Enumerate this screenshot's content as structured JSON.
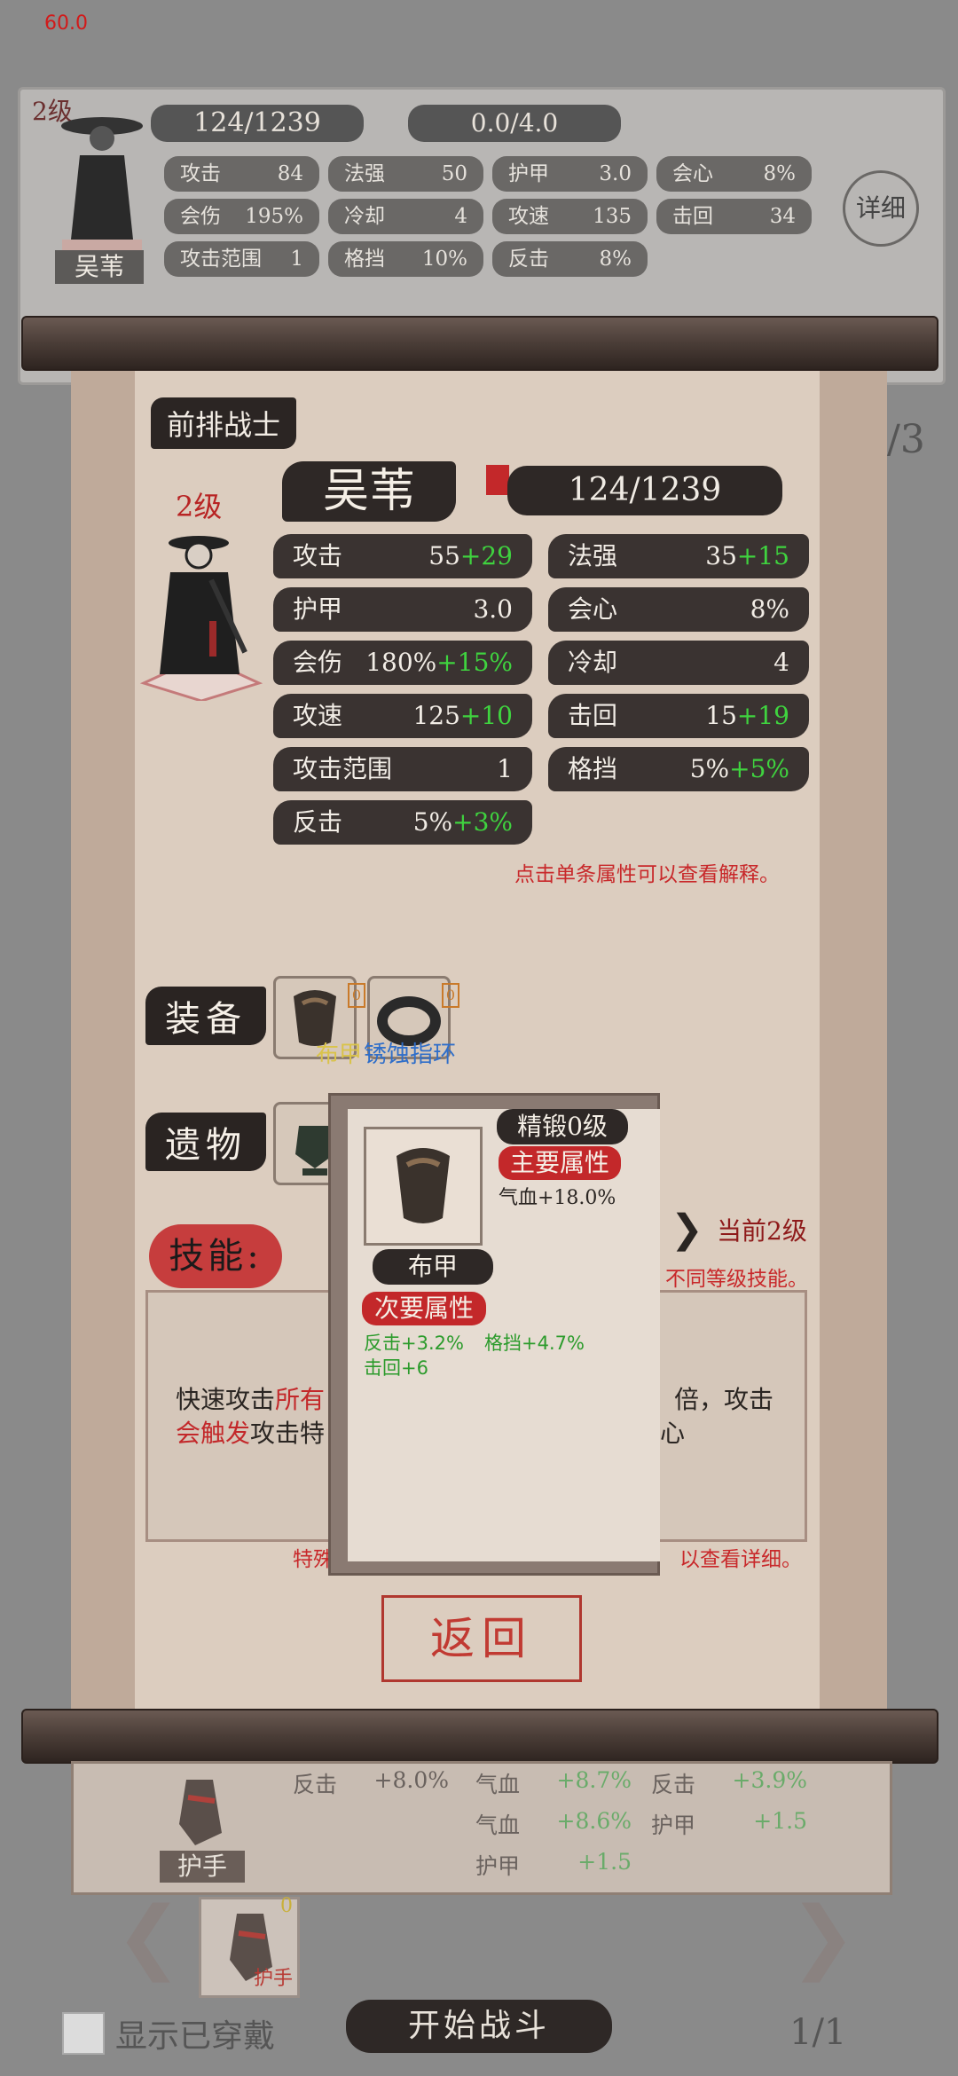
{
  "fps": "60.0",
  "bg_panel": {
    "level": "2级",
    "hp": "124/1239",
    "energy": "0.0/4.0",
    "name": "吴苇",
    "detail": "详细",
    "stats": [
      {
        "label": "攻击",
        "value": "84"
      },
      {
        "label": "法强",
        "value": "50"
      },
      {
        "label": "护甲",
        "value": "3.0"
      },
      {
        "label": "会心",
        "value": "8%"
      },
      {
        "label": "会伤",
        "value": "195%"
      },
      {
        "label": "冷却",
        "value": "4"
      },
      {
        "label": "攻速",
        "value": "135"
      },
      {
        "label": "击回",
        "value": "34"
      },
      {
        "label": "攻击范围",
        "value": "1"
      },
      {
        "label": "格挡",
        "value": "10%"
      },
      {
        "label": "反击",
        "value": "8%"
      }
    ],
    "page_hint": "/3"
  },
  "hero": {
    "role": "前排战士",
    "level": "2级",
    "name": "吴苇",
    "hp": "124/1239",
    "stats": [
      {
        "label": "攻击",
        "base": "55",
        "bonus": "+29"
      },
      {
        "label": "法强",
        "base": "35",
        "bonus": "+15"
      },
      {
        "label": "护甲",
        "base": "3.0",
        "bonus": ""
      },
      {
        "label": "会心",
        "base": "8%",
        "bonus": ""
      },
      {
        "label": "会伤",
        "base": "180%",
        "bonus": "+15%"
      },
      {
        "label": "冷却",
        "base": "4",
        "bonus": ""
      },
      {
        "label": "攻速",
        "base": "125",
        "bonus": "+10"
      },
      {
        "label": "击回",
        "base": "15",
        "bonus": "+19"
      },
      {
        "label": "攻击范围",
        "base": "1",
        "bonus": ""
      },
      {
        "label": "格挡",
        "base": "5%",
        "bonus": "+5%"
      },
      {
        "label": "反击",
        "base": "5%",
        "bonus": "+3%"
      }
    ],
    "stat_hint": "点击单条属性可以查看解释。"
  },
  "equipment": {
    "label": "装备",
    "items": [
      {
        "name": "布甲",
        "badge": "0"
      },
      {
        "name": "锈蚀指环",
        "badge": "0"
      }
    ]
  },
  "relics": {
    "label": "遗物"
  },
  "skill": {
    "label": "技能:",
    "current_level": "当前2级",
    "level_hint": "不同等级技能。",
    "desc_line1_a": "快速攻击",
    "desc_line1_b": "所有",
    "desc_line1_c": "倍，攻击",
    "desc_line2_a": "会触发",
    "desc_line2_b": "攻击特",
    "desc_line2_c": "心",
    "footer_left": "特殊",
    "footer_right": "以查看详细。"
  },
  "back_button": "返回",
  "tooltip": {
    "forge": "精锻0级",
    "main_label": "主要属性",
    "main_value": "气血+18.0%",
    "item_name": "布甲",
    "sub_label": "次要属性",
    "sub_1": "反击+3.2%",
    "sub_2": "格挡+4.7%",
    "sub_3": "击回+6"
  },
  "bottom": {
    "item_name": "护手",
    "stats_col1": [
      {
        "label": "反击",
        "value": "+8.0%"
      }
    ],
    "stats_col2": [
      {
        "label": "气血",
        "value": "+8.7%"
      },
      {
        "label": "气血",
        "value": "+8.6%"
      },
      {
        "label": "护甲",
        "value": "+1.5"
      }
    ],
    "stats_col3": [
      {
        "label": "反击",
        "value": "+3.9%"
      },
      {
        "label": "护甲",
        "value": "+1.5"
      }
    ],
    "inventory_item": "护手",
    "inventory_badge": "0",
    "show_equipped": "显示已穿戴",
    "start_battle": "开始战斗",
    "page": "1/1"
  }
}
